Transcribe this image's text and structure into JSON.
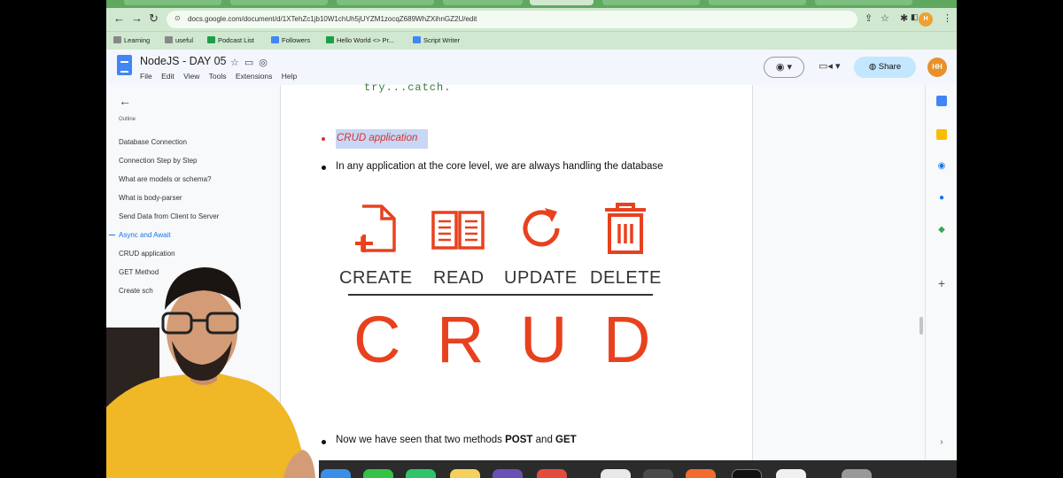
{
  "browser": {
    "url": "docs.google.com/document/d/1XTehZc1jb10W1chUh5jUYZM1zocqZ689WhZXihnGZ2U/edit",
    "profile_initials": "H",
    "bookmarks": [
      "Learning",
      "useful",
      "Podcast List",
      "Followers",
      "Hello World <> Pr...",
      "Script Writer"
    ]
  },
  "doc": {
    "title": "NodeJS - DAY 05",
    "menu": [
      "File",
      "Edit",
      "View",
      "Tools",
      "Extensions",
      "Help"
    ],
    "share_label": "Share",
    "avatar_initials": "HH"
  },
  "outline": {
    "title": "Outline",
    "items": [
      "Database Connection",
      "Connection Step by Step",
      "What are models or schema?",
      "What is body-parser",
      "Send Data from Client to Server",
      "Async and Await",
      "CRUD application",
      "GET Method",
      "Create sch"
    ],
    "active_index": 5
  },
  "content": {
    "code_line": "try...catch.",
    "heading": "CRUD application",
    "sentence": "In any application at the core level, we are always handling the database",
    "operations": [
      "CREATE",
      "READ",
      "UPDATE",
      "DELETE"
    ],
    "letters": [
      "C",
      "R",
      "U",
      "D"
    ],
    "last_line_prefix": "Now we have seen that two methods ",
    "last_line_post": "POST",
    "last_line_and": " and ",
    "last_line_get": "GET"
  },
  "colors": {
    "accent_red": "#e8411e",
    "browser_green": "#cfe8cf",
    "docs_blue": "#4285f4",
    "share_blue": "#c2e7ff"
  }
}
